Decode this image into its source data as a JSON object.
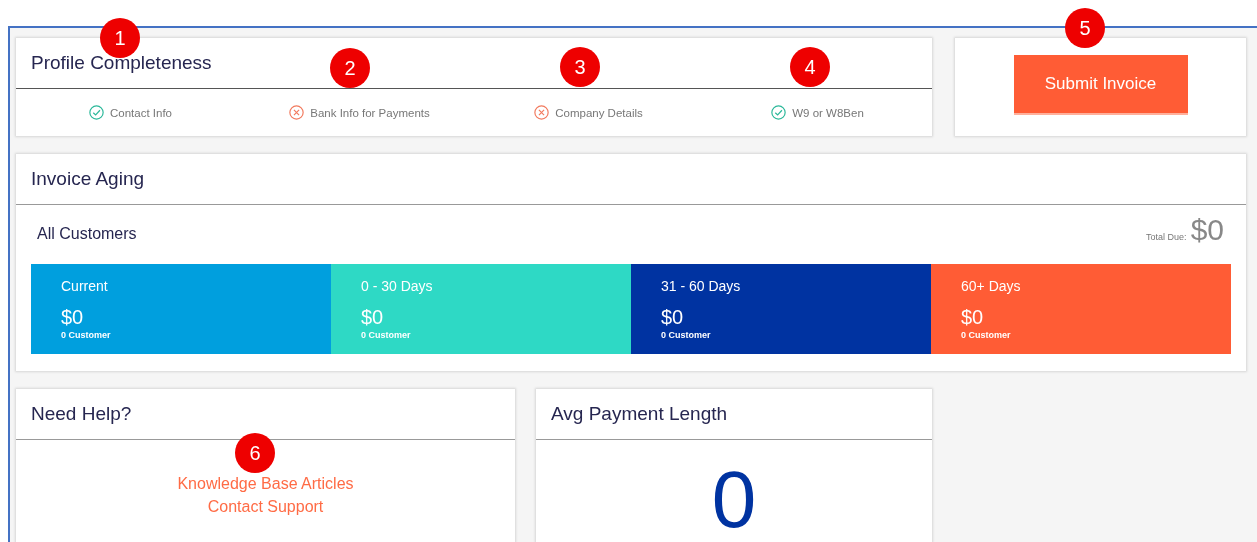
{
  "profile": {
    "title": "Profile Completeness",
    "items": [
      {
        "label": "Contact Info",
        "complete": true
      },
      {
        "label": "Bank Info for Payments",
        "complete": false
      },
      {
        "label": "Company Details",
        "complete": false
      },
      {
        "label": "W9 or W8Ben",
        "complete": true
      }
    ]
  },
  "submit_button": "Submit Invoice",
  "invoice_aging": {
    "title": "Invoice Aging",
    "scope": "All Customers",
    "total_due_label": "Total Due:",
    "total_due": "$0",
    "buckets": [
      {
        "label": "Current",
        "amount": "$0",
        "customers": "0 Customer",
        "color": "#009fde"
      },
      {
        "label": "0 - 30 Days",
        "amount": "$0",
        "customers": "0 Customer",
        "color": "#2ed9c5"
      },
      {
        "label": "31 - 60 Days",
        "amount": "$0",
        "customers": "0 Customer",
        "color": "#0033a1"
      },
      {
        "label": "60+ Days",
        "amount": "$0",
        "customers": "0 Customer",
        "color": "#ff5c35"
      }
    ]
  },
  "help": {
    "title": "Need Help?",
    "links": [
      "Knowledge Base Articles",
      "Contact Support"
    ]
  },
  "avg_payment": {
    "title": "Avg Payment Length",
    "value": "0"
  },
  "markers": [
    "1",
    "2",
    "3",
    "4",
    "5",
    "6"
  ]
}
